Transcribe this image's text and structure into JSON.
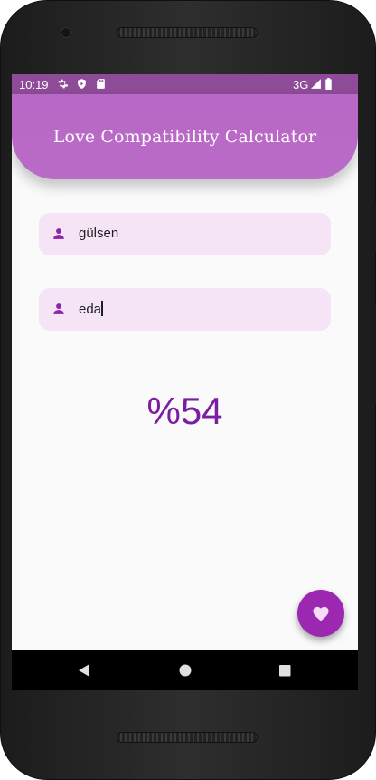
{
  "status_bar": {
    "time": "10:19",
    "network": "3G",
    "icons": [
      "gear-icon",
      "shield-play-icon",
      "sd-card-icon",
      "signal-icon",
      "battery-icon"
    ]
  },
  "app_bar": {
    "title": "Love Compatibility Calculator",
    "color": "#b868c6"
  },
  "form": {
    "name1": {
      "value": "gülsen",
      "icon": "person-icon"
    },
    "name2": {
      "value": "eda",
      "icon": "person-icon"
    }
  },
  "result": {
    "text": "%54",
    "color": "#7b1fa2"
  },
  "fab": {
    "icon": "heart-icon",
    "color": "#9c27b0"
  },
  "nav": {
    "icons": [
      "back-icon",
      "home-icon",
      "recents-icon"
    ]
  }
}
